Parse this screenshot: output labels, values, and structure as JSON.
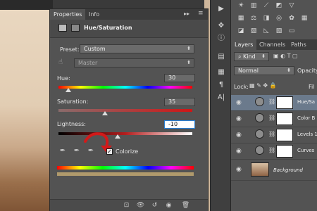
{
  "properties_panel": {
    "tabs": [
      "Properties",
      "Info"
    ],
    "title": "Hue/Saturation",
    "preset_label": "Preset:",
    "preset_value": "Custom",
    "channel_value": "Master",
    "hue_label": "Hue:",
    "hue_value": "30",
    "saturation_label": "Saturation:",
    "saturation_value": "35",
    "lightness_label": "Lightness:",
    "lightness_value": "-10",
    "colorize_label": "Colorize",
    "colorize_checked": true
  },
  "layers_panel": {
    "tabs": [
      "Layers",
      "Channels",
      "Paths"
    ],
    "kind_label": "Kind",
    "blend_mode": "Normal",
    "opacity_label": "Opacity",
    "lock_label": "Lock:",
    "fill_label": "Fil",
    "layers": [
      {
        "name": "Hue/Sa",
        "selected": true
      },
      {
        "name": "Color B",
        "selected": false
      },
      {
        "name": "Levels 1",
        "selected": false
      },
      {
        "name": "Curves",
        "selected": false
      },
      {
        "name": "Background",
        "selected": false
      }
    ]
  },
  "icons": {
    "accent_color": "#2a7fd4",
    "annotation_arrow_color": "#d21a1a"
  }
}
